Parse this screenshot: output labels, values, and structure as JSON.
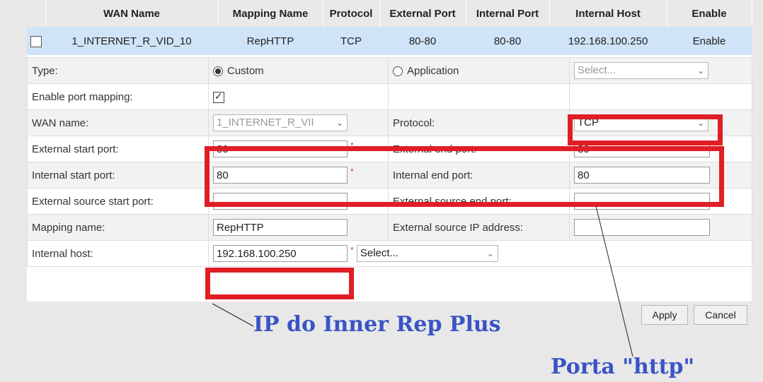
{
  "table_header": {
    "columns": [
      "WAN Name",
      "Mapping Name",
      "Protocol",
      "External Port",
      "Internal Port",
      "Internal Host",
      "Enable"
    ]
  },
  "table_row": {
    "wan_name": "1_INTERNET_R_VID_10",
    "mapping_name": "RepHTTP",
    "protocol": "TCP",
    "external_port": "80-80",
    "internal_port": "80-80",
    "internal_host": "192.168.100.250",
    "enable": "Enable"
  },
  "form": {
    "type_label": "Type:",
    "type_custom": "Custom",
    "type_application": "Application",
    "application_select_placeholder": "Select...",
    "enable_port_mapping_label": "Enable port mapping:",
    "wan_name_label": "WAN name:",
    "wan_name_value": "1_INTERNET_R_VII",
    "protocol_label": "Protocol:",
    "protocol_value": "TCP",
    "external_start_port_label": "External start port:",
    "external_start_port_value": "80",
    "external_end_port_label": "External end port:",
    "external_end_port_value": "80",
    "internal_start_port_label": "Internal start port:",
    "internal_start_port_value": "80",
    "internal_end_port_label": "Internal end port:",
    "internal_end_port_value": "80",
    "external_source_start_port_label": "External source start port:",
    "external_source_start_port_value": "",
    "external_source_end_port_label": "External source end port:",
    "external_source_end_port_value": "",
    "mapping_name_label": "Mapping name:",
    "mapping_name_value": "RepHTTP",
    "external_source_ip_label": "External source IP address:",
    "external_source_ip_value": "",
    "internal_host_label": "Internal host:",
    "internal_host_value": "192.168.100.250",
    "internal_host_select": "Select...",
    "required_mark": "*"
  },
  "buttons": {
    "apply": "Apply",
    "cancel": "Cancel"
  },
  "annotations": {
    "ip_note": "IP do Inner Rep Plus",
    "port_note": "Porta \"http\"",
    "highlight_color": "#e01e25",
    "note_color": "#3a54c6"
  }
}
